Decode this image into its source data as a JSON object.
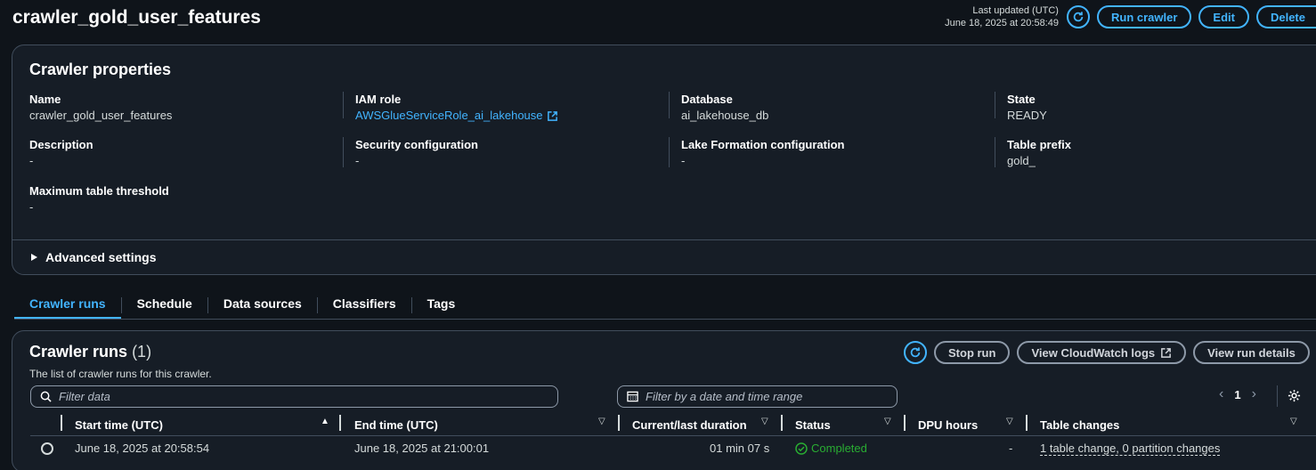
{
  "page": {
    "title": "crawler_gold_user_features",
    "last_updated_label": "Last updated (UTC)",
    "last_updated_value": "June 18, 2025 at 20:58:49",
    "buttons": {
      "run": "Run crawler",
      "edit": "Edit",
      "delete": "Delete"
    }
  },
  "properties": {
    "title": "Crawler properties",
    "name": {
      "label": "Name",
      "value": "crawler_gold_user_features"
    },
    "iam_role": {
      "label": "IAM role",
      "value": "AWSGlueServiceRole_ai_lakehouse"
    },
    "database": {
      "label": "Database",
      "value": "ai_lakehouse_db"
    },
    "state": {
      "label": "State",
      "value": "READY"
    },
    "description": {
      "label": "Description",
      "value": "-"
    },
    "security_config": {
      "label": "Security configuration",
      "value": "-"
    },
    "lake_formation": {
      "label": "Lake Formation configuration",
      "value": "-"
    },
    "table_prefix": {
      "label": "Table prefix",
      "value": "gold_"
    },
    "max_threshold": {
      "label": "Maximum table threshold",
      "value": "-"
    },
    "advanced": "Advanced settings"
  },
  "tabs": [
    "Crawler runs",
    "Schedule",
    "Data sources",
    "Classifiers",
    "Tags"
  ],
  "runs": {
    "title": "Crawler runs",
    "count": "(1)",
    "description": "The list of crawler runs for this crawler.",
    "buttons": {
      "stop": "Stop run",
      "logs": "View CloudWatch logs",
      "details": "View run details"
    },
    "filter_placeholder": "Filter data",
    "date_placeholder": "Filter by a date and time range",
    "page": "1",
    "columns": [
      "Start time (UTC)",
      "End time (UTC)",
      "Current/last duration",
      "Status",
      "DPU hours",
      "Table changes"
    ],
    "rows": [
      {
        "start": "June 18, 2025 at 20:58:54",
        "end": "June 18, 2025 at 21:00:01",
        "duration": "01 min 07 s",
        "status": "Completed",
        "dpu": "-",
        "changes": "1 table change, 0 partition changes"
      }
    ]
  },
  "colors": {
    "accent": "#42b4ff",
    "success": "#29ad32",
    "background": "#0f141a",
    "card": "#161d26"
  }
}
